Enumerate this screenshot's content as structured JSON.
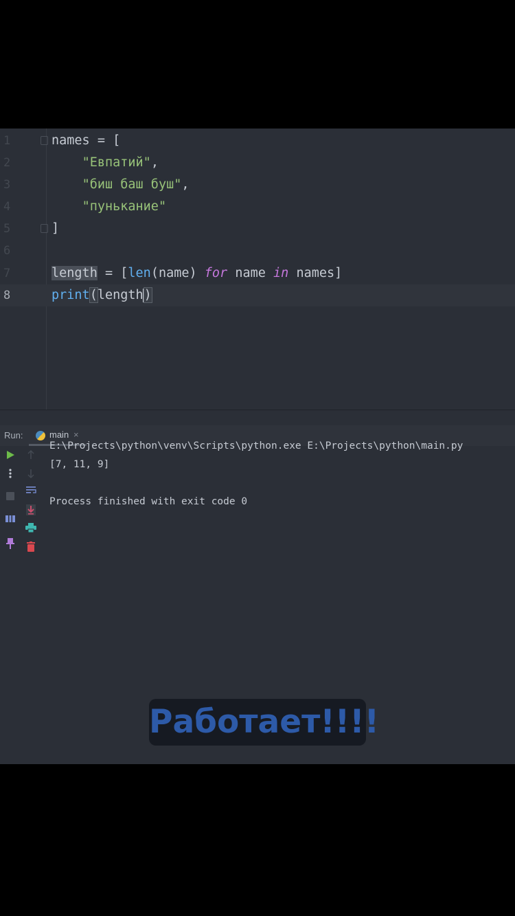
{
  "editor": {
    "line_numbers": [
      "1",
      "2",
      "3",
      "4",
      "5",
      "6",
      "7",
      "8"
    ],
    "l1": {
      "name": "names",
      "eq": " = ["
    },
    "l2": {
      "indent": "    ",
      "str": "\"Евпатий\"",
      "comma": ","
    },
    "l3": {
      "indent": "    ",
      "str": "\"биш баш буш\"",
      "comma": ","
    },
    "l4": {
      "indent": "    ",
      "str": "\"пунькание\""
    },
    "l5": {
      "close": "]"
    },
    "l7": {
      "var": "length",
      "eq": " = [",
      "fn": "len",
      "args": "(name) ",
      "kw_for": "for",
      "mid": " name ",
      "kw_in": "in",
      "end": " names]"
    },
    "l8": {
      "fn": "print",
      "open": "(",
      "arg": "length",
      "close": ")"
    }
  },
  "run_panel": {
    "label": "Run:",
    "tab_label": "main",
    "tab_close": "×",
    "console": {
      "command": "E:\\Projects\\python\\venv\\Scripts\\python.exe E:\\Projects\\python\\main.py",
      "output": "[7, 11, 9]",
      "exit": "Process finished with exit code 0"
    },
    "colors": {
      "run": "#6dbb4a",
      "rerun_down": "#c94f6d",
      "print": "#3fb7b0",
      "trash": "#d9484f",
      "pin": "#b07bd8",
      "wrap": "#7a8fd6"
    }
  },
  "caption": "Работает!!!!"
}
